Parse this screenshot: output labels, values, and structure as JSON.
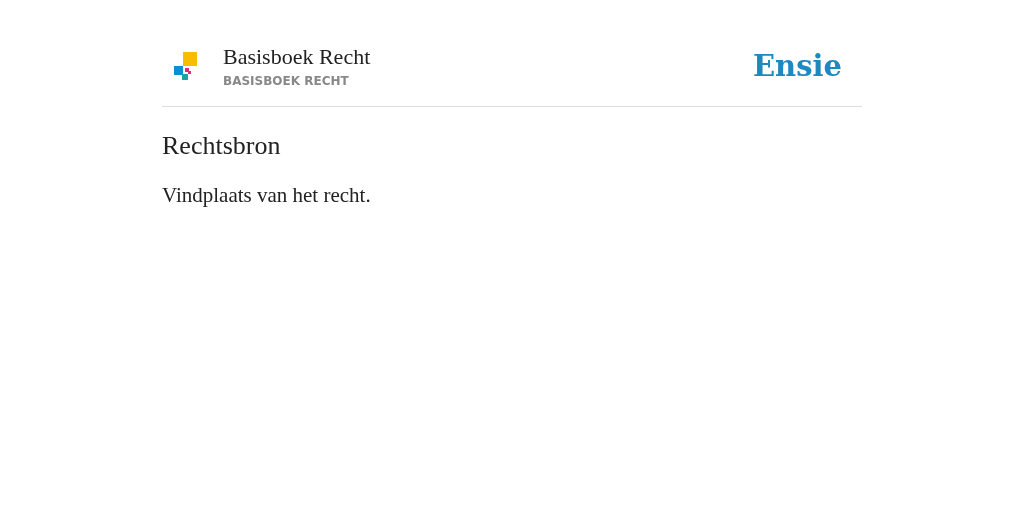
{
  "header": {
    "title": "Basisboek Recht",
    "subtitle": "BASISBOEK RECHT",
    "brand": "Ensie"
  },
  "entry": {
    "term": "Rechtsbron",
    "definition": "Vindplaats van het recht."
  }
}
